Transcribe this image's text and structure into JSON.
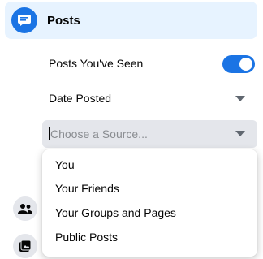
{
  "posts_section": {
    "title": "Posts",
    "icon": "posts-icon",
    "accent_color": "#1b74e4"
  },
  "filters": {
    "seen_label": "Posts You've Seen",
    "seen_enabled": true,
    "date_label": "Date Posted",
    "source_placeholder": "Choose a Source..."
  },
  "source_dropdown": {
    "options": [
      "You",
      "Your Friends",
      "Your Groups and Pages",
      "Public Posts"
    ]
  },
  "sidebar_icons": [
    "people-icon",
    "photos-icon"
  ]
}
